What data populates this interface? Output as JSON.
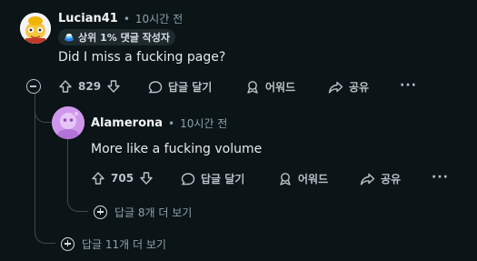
{
  "comment": {
    "username": "Lucian41",
    "time": "10시간 전",
    "badge": "상위 1% 댓글 작성자",
    "text": "Did I miss a fucking page?",
    "votes": "829",
    "reply_label": "답글 달기",
    "award_label": "어워드",
    "share_label": "공유",
    "more_replies": "답글 11개 더 보기"
  },
  "reply": {
    "username": "Alamerona",
    "time": "10시간 전",
    "text": "More like a fucking volume",
    "votes": "705",
    "reply_label": "답글 달기",
    "award_label": "어워드",
    "share_label": "공유",
    "more_replies": "답글 8개 더 보기"
  },
  "separator": "•",
  "colors": {
    "background": "#0b1416",
    "text": "#e6eaec",
    "muted": "#8ba2ad",
    "line": "#3e4a4f"
  }
}
